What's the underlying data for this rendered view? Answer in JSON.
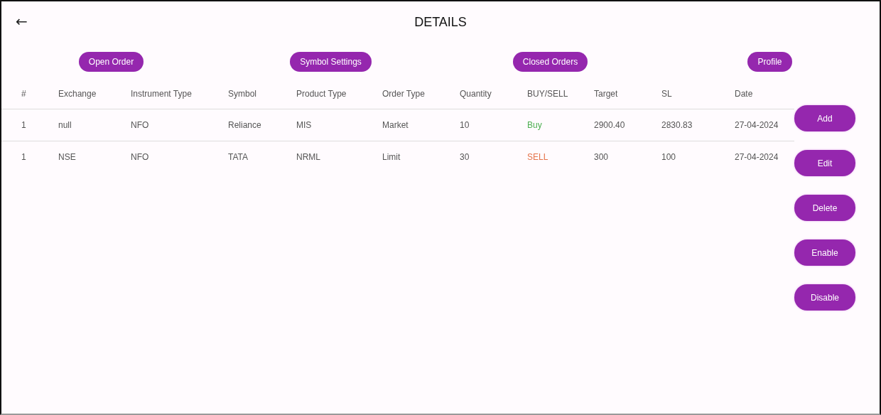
{
  "header": {
    "back_icon": "←",
    "title": "DETAILS"
  },
  "nav_buttons": [
    "Open Order",
    "Symbol Settings",
    "Closed Orders",
    "Profile"
  ],
  "table": {
    "columns": [
      "#",
      "Exchange",
      "Instrument Type",
      "Symbol",
      "Product Type",
      "Order Type",
      "Quantity",
      "BUY/SELL",
      "Target",
      "SL",
      "Date"
    ],
    "rows": [
      {
        "cells": [
          "1",
          "null",
          "NFO",
          "Reliance",
          "MIS",
          "Market",
          "10",
          "Buy",
          "2900.40",
          "2830.83",
          "27-04-2024"
        ],
        "kind": "buy"
      },
      {
        "cells": [
          "1",
          "NSE",
          "NFO",
          "TATA",
          "NRML",
          "Limit",
          "30",
          "SELL",
          "300",
          "100",
          "27-04-2024"
        ],
        "kind": "sell"
      }
    ]
  },
  "action_buttons": [
    "Add",
    "Edit",
    "Delete",
    "Enable",
    "Disable"
  ]
}
